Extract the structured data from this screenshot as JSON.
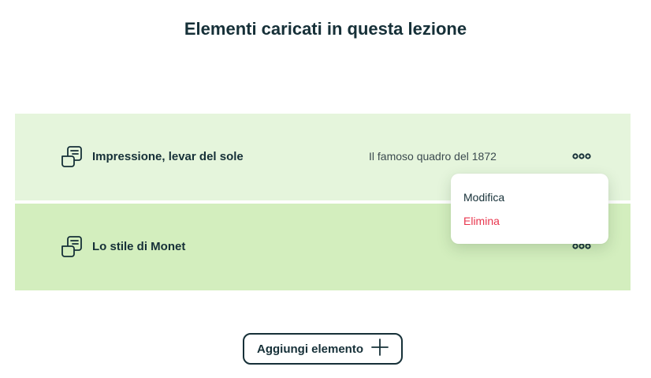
{
  "page": {
    "title": "Elementi caricati in questa lezione"
  },
  "items": [
    {
      "title": "Impressione, levar del sole",
      "description": "Il famoso quadro del 1872",
      "icon": "document-stack-icon",
      "menu_icon": "more-options-icon"
    },
    {
      "title": "Lo stile di Monet",
      "description": "",
      "icon": "document-stack-icon",
      "menu_icon": "more-options-icon"
    }
  ],
  "context_menu": {
    "edit_label": "Modifica",
    "delete_label": "Elimina",
    "delete_color": "#e8364e"
  },
  "add_button": {
    "label": "Aggiungi elemento",
    "icon": "plus-icon"
  },
  "colors": {
    "text": "#163038",
    "row_1_bg": "#e5f5dc",
    "row_2_bg": "#d3eebe"
  }
}
